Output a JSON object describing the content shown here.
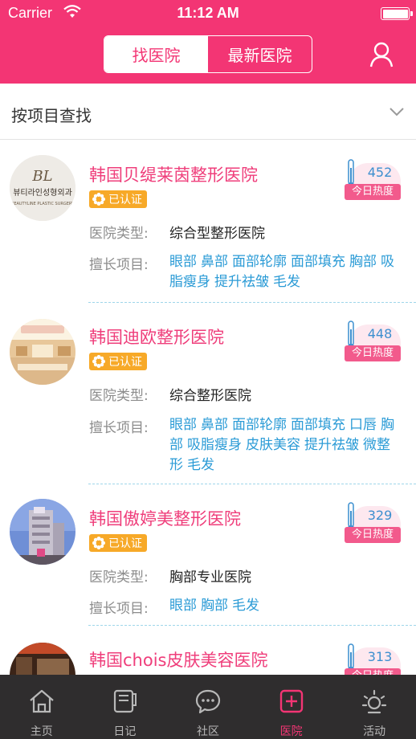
{
  "status_bar": {
    "carrier": "Carrier",
    "time": "11:12 AM"
  },
  "header": {
    "tabs": [
      {
        "label": "找医院",
        "active": true
      },
      {
        "label": "最新医院",
        "active": false
      }
    ],
    "accent_color": "#f33574"
  },
  "filter": {
    "label": "按项目查找"
  },
  "labels": {
    "type": "医院类型:",
    "specialty": "擅长项目:",
    "heat": "今日热度"
  },
  "hospitals": [
    {
      "name": "韩国贝缇莱茵整形医院",
      "badge": "已认证",
      "heat": "452",
      "type": "综合型整形医院",
      "avatar_text": "뷰티라인성형외과",
      "avatar_sub": "BEAUTYLINE PLASTIC SURGERY",
      "tags": [
        "眼部",
        "鼻部",
        "面部轮廓",
        "面部填充",
        "胸部",
        "吸脂瘦身",
        "提升祛皱",
        "毛发"
      ]
    },
    {
      "name": "韩国迪欧整形医院",
      "badge": "已认证",
      "heat": "448",
      "type": "综合整形医院",
      "tags": [
        "眼部",
        "鼻部",
        "面部轮廓",
        "面部填充",
        "口唇",
        "胸部",
        "吸脂瘦身",
        "皮肤美容",
        "提升祛皱",
        "微整形",
        "毛发"
      ]
    },
    {
      "name": "韩国傲婷美整形医院",
      "badge": "已认证",
      "heat": "329",
      "type": "胸部专业医院",
      "tags": [
        "眼部",
        "胸部",
        "毛发"
      ]
    },
    {
      "name": "韩国chois皮肤美容医院",
      "heat": "313"
    }
  ],
  "tabbar": [
    {
      "label": "主页",
      "icon": "home-icon",
      "active": false
    },
    {
      "label": "日记",
      "icon": "diary-icon",
      "active": false
    },
    {
      "label": "社区",
      "icon": "chat-bubble-icon",
      "active": false
    },
    {
      "label": "医院",
      "icon": "plus-square-icon",
      "active": true
    },
    {
      "label": "活动",
      "icon": "sun-icon",
      "active": false
    }
  ]
}
